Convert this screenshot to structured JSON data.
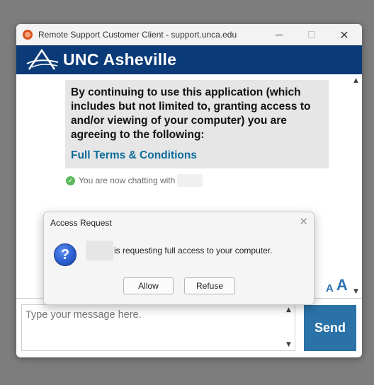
{
  "window": {
    "title": "Remote Support Customer Client - support.unca.edu",
    "minimize_icon": "minimize-icon",
    "maximize_icon": "maximize-icon",
    "close_glyph": "✕"
  },
  "brand": {
    "name": "UNC Asheville",
    "bar_color": "#0a3a78"
  },
  "chat": {
    "terms_text": "By continuing to use this application (which includes but not limited to, granting access to and/or viewing of your computer) you are agreeing to the following:",
    "terms_link": "Full Terms & Conditions",
    "status_text": "You are now chatting with",
    "scroll_up": "▲",
    "scroll_down": "▼"
  },
  "font_controls": {
    "decrease": "A",
    "increase": "A"
  },
  "composer": {
    "placeholder": "Type your message here.",
    "send_label": "Send",
    "send_color": "#2a72a8"
  },
  "dialog": {
    "title": "Access Request",
    "close_glyph": "✕",
    "icon_glyph": "?",
    "message": "is requesting full access to your computer.",
    "allow_label": "Allow",
    "refuse_label": "Refuse"
  }
}
